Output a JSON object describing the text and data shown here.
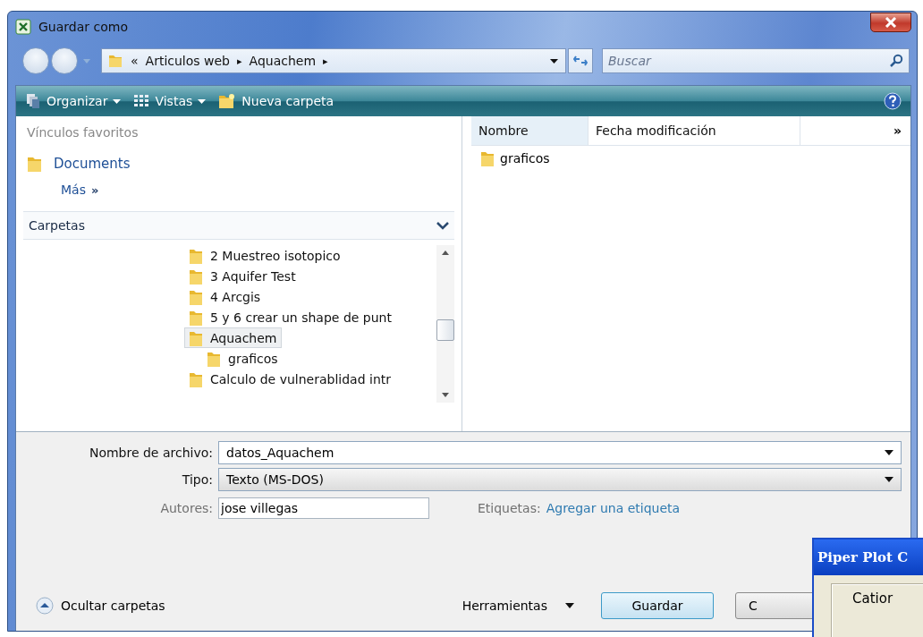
{
  "window": {
    "title": "Guardar como"
  },
  "address": {
    "crumbs": [
      "«",
      "Articulos web",
      "Aquachem"
    ],
    "separator": "▸"
  },
  "search": {
    "placeholder": "Buscar"
  },
  "toolbar": {
    "items": [
      {
        "label": "Organizar",
        "kind": "organize"
      },
      {
        "label": "Vistas",
        "kind": "views"
      },
      {
        "label": "Nueva carpeta",
        "kind": "newfolder"
      }
    ]
  },
  "favorites": {
    "header": "Vínculos favoritos",
    "links": [
      "Documents"
    ],
    "more": "Más",
    "more_mark": "»"
  },
  "folders": {
    "header": "Carpetas",
    "tree": [
      {
        "label": "2 Muestreo isotopico",
        "selected": false
      },
      {
        "label": "3 Aquifer Test",
        "selected": false
      },
      {
        "label": "4 Arcgis",
        "selected": false
      },
      {
        "label": "5 y 6 crear un shape de punt",
        "selected": false
      },
      {
        "label": "Aquachem",
        "selected": true,
        "children": [
          {
            "label": "graficos",
            "selected": false
          }
        ]
      },
      {
        "label": "Calculo de vulnerablidad intr",
        "selected": false
      }
    ]
  },
  "file_list": {
    "columns": [
      "Nombre",
      "Fecha modificación"
    ],
    "more_columns": "»",
    "items": [
      "graficos"
    ]
  },
  "form": {
    "filename_label": "Nombre de archivo:",
    "filename": "datos_Aquachem",
    "type_label": "Tipo:",
    "type": "Texto (MS-DOS)",
    "authors_label": "Autores:",
    "authors": "jose villegas",
    "tags_label": "Etiquetas:",
    "tags_link": "Agregar una etiqueta"
  },
  "footer": {
    "hide_folders": "Ocultar carpetas",
    "tools": "Herramientas",
    "save": "Guardar",
    "cancel": "C"
  },
  "overlay_window": {
    "title": "Piper Plot C",
    "group": "Catior"
  }
}
